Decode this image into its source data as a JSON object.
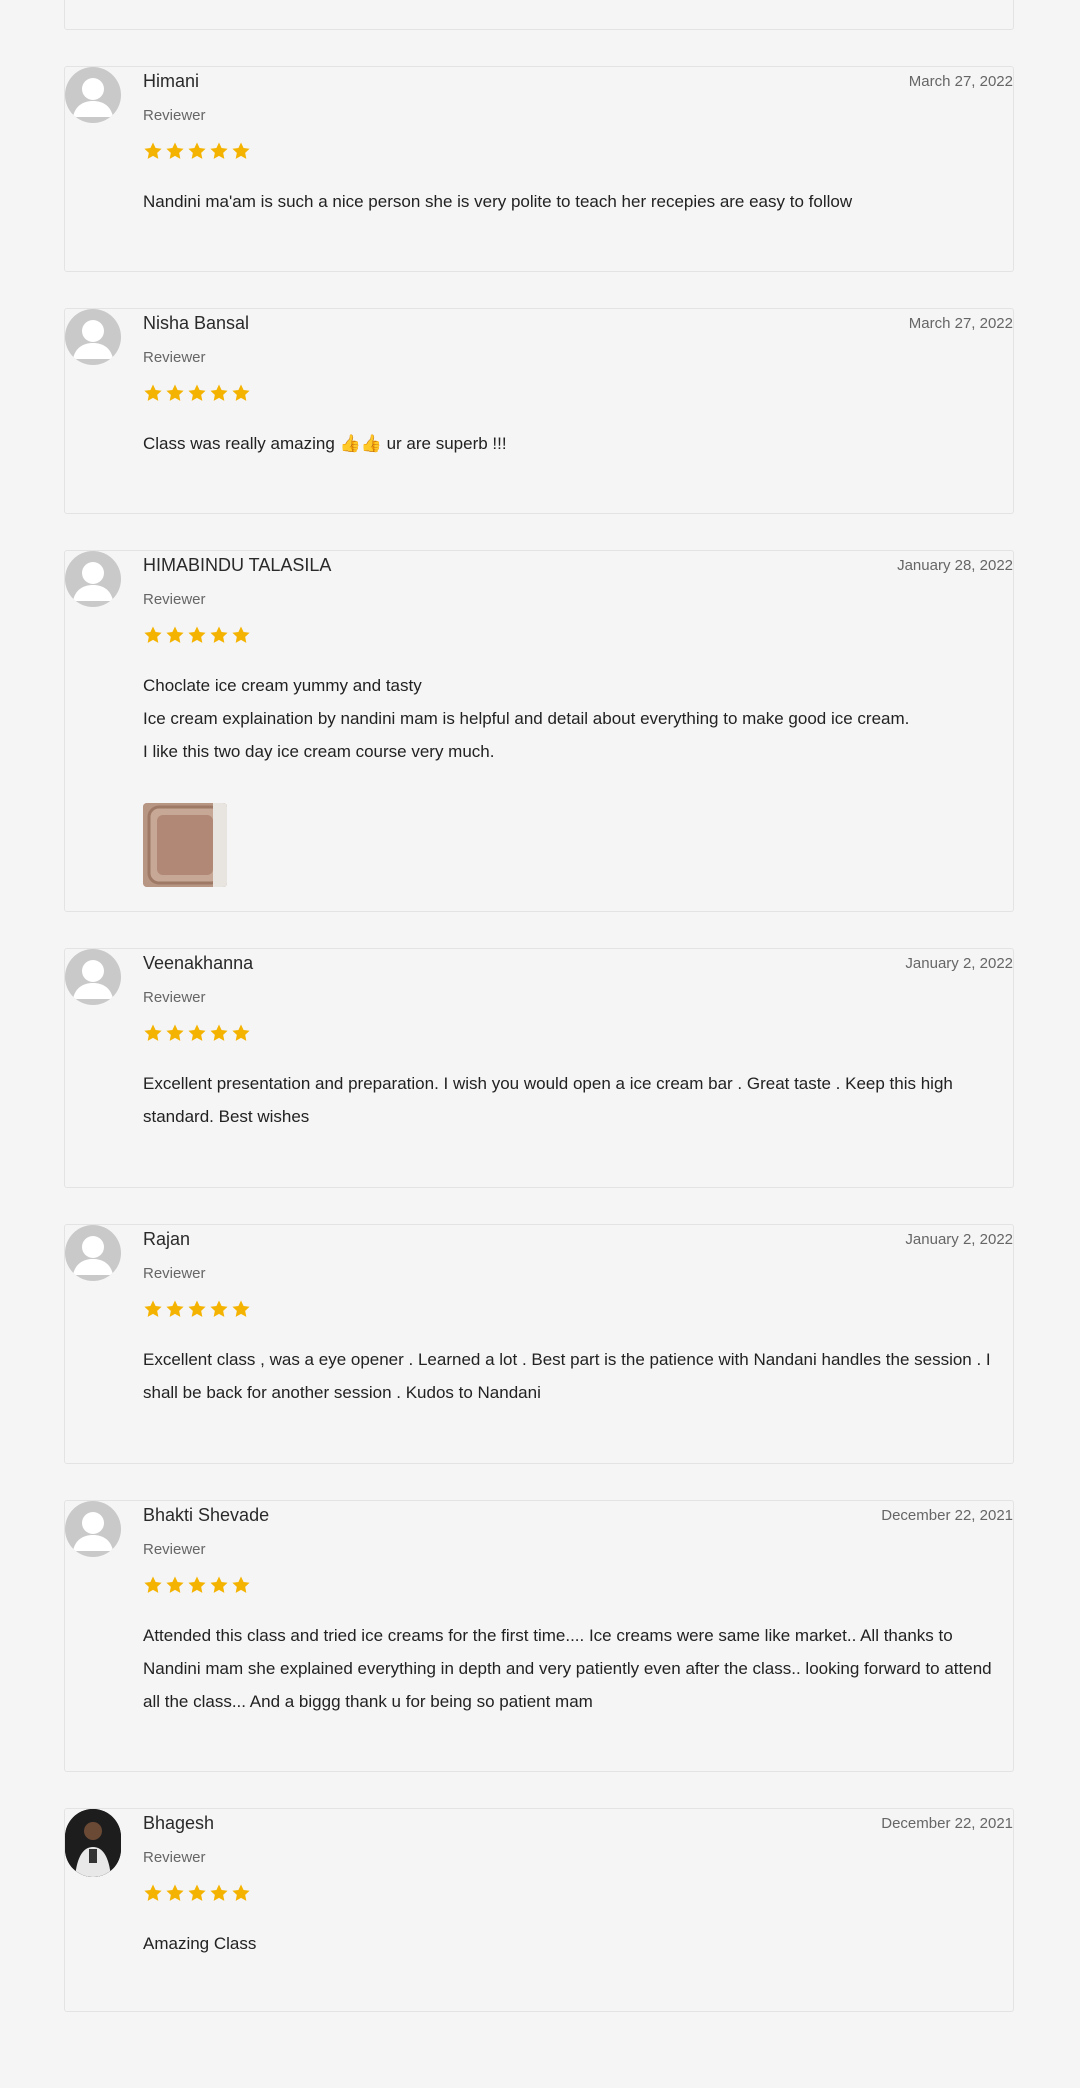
{
  "reviews": [
    {
      "name": "Himani",
      "role": "Reviewer",
      "date": "March 27, 2022",
      "rating": 5,
      "text": [
        "Nandini ma'am is such a nice person she is very polite to teach her recepies are easy to follow"
      ]
    },
    {
      "name": "Nisha Bansal",
      "role": "Reviewer",
      "date": "March 27, 2022",
      "rating": 5,
      "text": [
        "Class was really amazing 👍👍 ur are superb !!!"
      ]
    },
    {
      "name": "HIMABINDU TALASILA",
      "role": "Reviewer",
      "date": "January 28, 2022",
      "rating": 5,
      "text": [
        "Choclate ice cream yummy and tasty",
        "Ice cream explaination by nandini mam is helpful and detail about everything to make good ice cream.",
        "I like this two day ice cream course very much."
      ],
      "has_photo": true
    },
    {
      "name": "Veenakhanna",
      "role": "Reviewer",
      "date": "January 2, 2022",
      "rating": 5,
      "text": [
        "Excellent presentation and preparation. I wish you would open a ice cream bar . Great taste . Keep this high standard. Best wishes"
      ]
    },
    {
      "name": "Rajan",
      "role": "Reviewer",
      "date": "January 2, 2022",
      "rating": 5,
      "text": [
        "Excellent class , was a eye opener . Learned a lot . Best part is the patience with Nandani handles the session . I shall be back for another session . Kudos to Nandani"
      ]
    },
    {
      "name": "Bhakti Shevade",
      "role": "Reviewer",
      "date": "December 22, 2021",
      "rating": 5,
      "text": [
        "Attended this class and tried ice creams for the first time.... Ice creams were same like market.. All thanks to Nandini mam she explained everything in depth and very patiently even after the class.. looking forward to attend all the class... And a biggg thank u for being so patient mam"
      ]
    },
    {
      "name": "Bhagesh",
      "role": "Reviewer",
      "date": "December 22, 2021",
      "rating": 5,
      "text": [
        "Amazing Class"
      ],
      "avatar_photo": true
    }
  ],
  "colors": {
    "star": "#f5b301",
    "background": "#f5f5f5",
    "avatar": "#c9c9c9"
  },
  "icons": {
    "star": "star-icon",
    "avatar": "default-avatar-icon"
  }
}
